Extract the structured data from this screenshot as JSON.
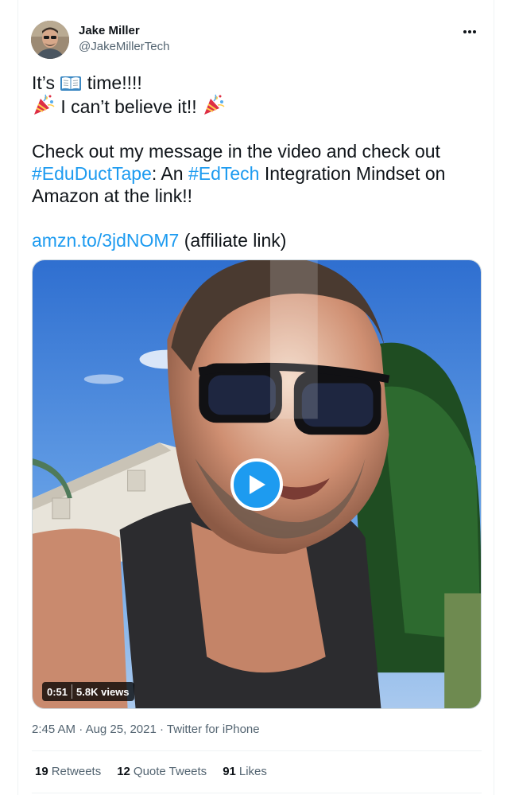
{
  "author": {
    "name": "Jake Miller",
    "handle": "@JakeMillerTech"
  },
  "tweet": {
    "line1_before": "It’s",
    "line1_after": "time!!!!",
    "line1_emoji": "open-book-emoji",
    "line2_text": "I can’t believe it!!",
    "line2_emoji": "party-popper-emoji",
    "para2_line1": "Check out my message in the video and check out",
    "hashtag1": "#EduDuctTape",
    "para2_mid": ": An",
    "hashtag2": "#EdTech",
    "para2_end": "Integration Mindset on",
    "para2_line3": "Amazon at the link!!",
    "short_link": "amzn.to/3jdNOM7",
    "link_suffix": "(affiliate link)"
  },
  "video": {
    "duration": "0:51",
    "views": "5.8K views"
  },
  "meta": {
    "time": "2:45 AM",
    "sep1": "·",
    "date": "Aug 25, 2021",
    "sep2": "·",
    "source": "Twitter for iPhone"
  },
  "stats": {
    "retweets_count": "19",
    "retweets_label": "Retweets",
    "quotes_count": "12",
    "quotes_label": "Quote Tweets",
    "likes_count": "91",
    "likes_label": "Likes"
  },
  "colors": {
    "link": "#1d9bf0",
    "text": "#0f1419",
    "secondary": "#536471"
  }
}
